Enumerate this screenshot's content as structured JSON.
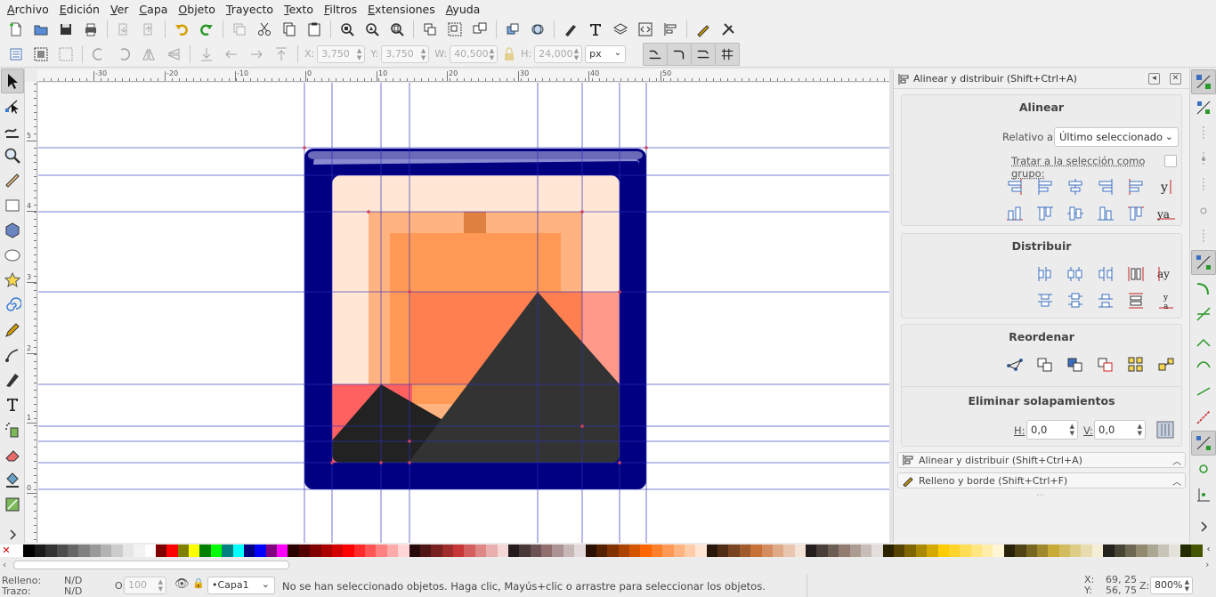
{
  "menu": [
    {
      "label": "Archivo",
      "ul": "A",
      "rest": "rchivo"
    },
    {
      "label": "Edición",
      "ul": "E",
      "rest": "dición"
    },
    {
      "label": "Ver",
      "ul": "V",
      "rest": "er"
    },
    {
      "label": "Capa",
      "ul": "C",
      "rest": "apa"
    },
    {
      "label": "Objeto",
      "ul": "O",
      "rest": "bjeto"
    },
    {
      "label": "Trayecto",
      "ul": "T",
      "rest": "rayecto"
    },
    {
      "label": "Texto",
      "ul": "T",
      "rest": "exto"
    },
    {
      "label": "Filtros",
      "ul": "F",
      "rest": "iltros"
    },
    {
      "label": "Extensiones",
      "ul": "E",
      "rest": "xtensiones"
    },
    {
      "label": "Ayuda",
      "ul": "A",
      "rest": "yuda"
    }
  ],
  "controls": {
    "x_label": "X:",
    "x_value": "3,750",
    "y_label": "Y:",
    "y_value": "3,750",
    "w_label": "W:",
    "w_value": "40,500",
    "h_label": "H:",
    "h_value": "24,000",
    "unit": "px"
  },
  "ruler": {
    "h_labels": [
      "-30",
      "-20",
      "-10",
      "0",
      "10",
      "20",
      "30",
      "40",
      "50"
    ],
    "v_labels": [
      "5",
      "4",
      "3",
      "2",
      "1",
      "0"
    ]
  },
  "dock": {
    "title": "Alinear y distribuir (Shift+Ctrl+A)",
    "align": {
      "heading": "Alinear",
      "relative_label": "Relativo a:",
      "relative_value": "Último seleccionado",
      "group_label": "Tratar a la selección como grupo:"
    },
    "distribute": {
      "heading": "Distribuir"
    },
    "reorder": {
      "heading": "Reordenar"
    },
    "overlap": {
      "heading": "Eliminar solapamientos",
      "h_label": "H:",
      "h_value": "0,0",
      "v_label": "V:",
      "v_value": "0,0"
    },
    "collapsed_panels": [
      "Alinear y distribuir (Shift+Ctrl+A)",
      "Relleno y borde (Shift+Ctrl+F)"
    ]
  },
  "status": {
    "fill_label": "Relleno:",
    "fill_value": "N/D",
    "stroke_label": "Trazo:",
    "stroke_value": "N/D",
    "opacity_label": "O:",
    "opacity_value": "100",
    "layer": "•Capa1",
    "message": "No se han seleccionado objetos. Haga clic, Mayús+clic o arrastre para seleccionar los objetos.",
    "x_label": "X:",
    "x_value": "69, 25",
    "y_label": "Y:",
    "y_value": "56, 75",
    "zoom_label": "Z:",
    "zoom_value": "800%"
  },
  "colors": {
    "page_frame": "#000080",
    "frame_highlight": "#8a8ad0",
    "sky_light": "#ffe6d5",
    "sky_mid": "#ffb380",
    "sun": "#ff9955",
    "sun_dark": "#e08040",
    "sunset": "#ff7f50",
    "pink": "#ff9a8a",
    "red": "#ff6060",
    "mountain_dark": "#333333",
    "mountain_darker": "#222222",
    "guide": "#3030c0"
  },
  "palette": [
    "#ffffff",
    "#000000",
    "#1a1a1a",
    "#333333",
    "#4d4d4d",
    "#666666",
    "#808080",
    "#999999",
    "#b3b3b3",
    "#cccccc",
    "#e6e6e6",
    "#f2f2f2",
    "#ffffff",
    "#800000",
    "#ff0000",
    "#808000",
    "#ffff00",
    "#008000",
    "#00ff00",
    "#008080",
    "#00ffff",
    "#000080",
    "#0000ff",
    "#800080",
    "#ff00ff",
    "#2b0000",
    "#550000",
    "#800000",
    "#aa0000",
    "#d40000",
    "#ff0000",
    "#ff2a2a",
    "#ff5555",
    "#ff8080",
    "#ffaaaa",
    "#ffd5d5",
    "#280b0b",
    "#501616",
    "#782121",
    "#a02c2c",
    "#c83737",
    "#d35f5f",
    "#de8787",
    "#e9afaf",
    "#f4d7d7",
    "#241c1c",
    "#483737",
    "#6c5353",
    "#916f6f",
    "#ac9393",
    "#c8b7b7",
    "#e3dbdb",
    "#2b1100",
    "#552200",
    "#803300",
    "#aa4400",
    "#d45500",
    "#ff6600",
    "#ff7f2a",
    "#ff9955",
    "#ffb380",
    "#ffccaa",
    "#ffe6d5",
    "#28170b",
    "#502d16",
    "#784421",
    "#a05a2c",
    "#c87137",
    "#d38d5f",
    "#deaa87",
    "#e9c6af",
    "#f4e3d7",
    "#241f1c",
    "#483e37",
    "#6c5d53",
    "#917c6f",
    "#ac9d93",
    "#c8beb7",
    "#e3dedb",
    "#2b2200",
    "#554400",
    "#806600",
    "#aa8800",
    "#d4aa00",
    "#ffcc00",
    "#ffd42a",
    "#ffdd55",
    "#ffe680",
    "#ffeeaa",
    "#fff6d5",
    "#28220b",
    "#504416",
    "#786721",
    "#a0892c",
    "#c8ab37",
    "#d3bc5f",
    "#decd87",
    "#e9ddaf",
    "#f4eed7",
    "#24221c",
    "#484537",
    "#6c6753",
    "#918a6f",
    "#aca793",
    "#c8c4b7",
    "#e3e2db",
    "#222b00",
    "#445500"
  ]
}
